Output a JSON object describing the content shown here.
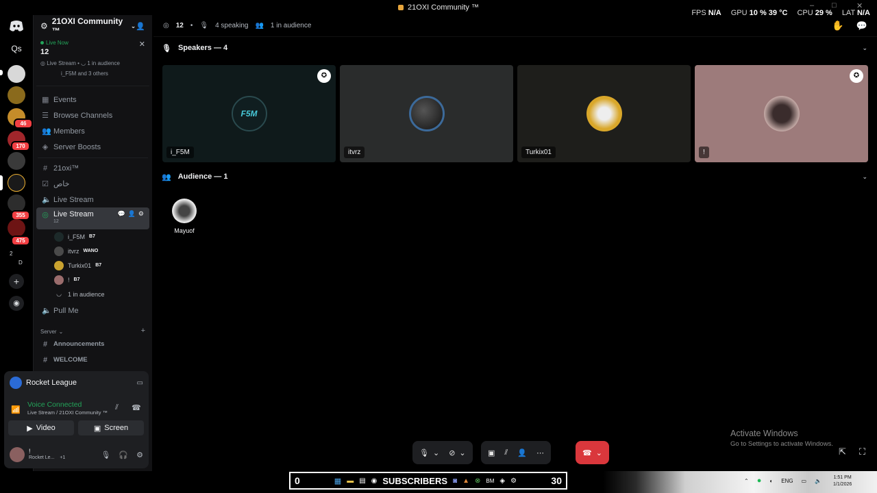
{
  "window": {
    "title": "21OXI Community ™",
    "controls": [
      "–",
      "□",
      "✕"
    ]
  },
  "perf": {
    "fps_label": "FPS",
    "fps_value": "N/A",
    "gpu_label": "GPU",
    "gpu_value": "10 %",
    "gpu_temp": "39 °C",
    "cpu_label": "CPU",
    "cpu_value": "29 %",
    "lat_label": "LAT",
    "lat_value": "N/A"
  },
  "rail": {
    "home_icon": "discord-icon",
    "dm_label": "Qs",
    "badges": [
      "46",
      "170",
      "355",
      "475"
    ],
    "folder_label_1": "2",
    "folder_label_2": "D"
  },
  "server": {
    "name": "21OXI Community ™"
  },
  "live_card": {
    "live_now": "Live Now",
    "count": "12",
    "meta_1": "Live Stream",
    "meta_2": "1 in audience",
    "users": "i_F5M and 3 others"
  },
  "nav": [
    "Events",
    "Browse Channels",
    "Members",
    "Server Boosts"
  ],
  "channels": {
    "ch1": "21oxi™",
    "ch2": "خاص",
    "ch3": "Live Stream",
    "active": {
      "name": "Live Stream",
      "count": "12"
    },
    "members": [
      {
        "name": "i_F5M",
        "tag": "B7"
      },
      {
        "name": "itvrz",
        "tag": "WANO"
      },
      {
        "name": "Turkix01",
        "tag": "B7"
      },
      {
        "name": "!",
        "tag": "B7"
      }
    ],
    "audience": "1 in audience",
    "pullme": "Pull Me",
    "category": "Server",
    "text1": "Announcements",
    "text2": "WELCOME"
  },
  "game": {
    "name": "Rocket League"
  },
  "voice": {
    "status": "Voice Connected",
    "location": "Live Stream / 21OXI Community ™",
    "video": "Video",
    "screen": "Screen"
  },
  "user": {
    "name": "!",
    "activity": "Rocket Le...",
    "extra": "+1"
  },
  "topbar": {
    "listeners": "12",
    "speaking": "4 speaking",
    "audience": "1 in audience"
  },
  "speakers": {
    "title": "Speakers — 4",
    "tiles": [
      {
        "name": "i_F5M",
        "logo": "F5M"
      },
      {
        "name": "itvrz"
      },
      {
        "name": "Turkix01"
      },
      {
        "name": "!"
      }
    ]
  },
  "audience": {
    "title": "Audience — 1",
    "member": "Mayuof"
  },
  "activate": {
    "title": "Activate Windows",
    "sub": "Go to Settings to activate Windows."
  },
  "taskbar": {
    "left": "0",
    "banner": "SUBSCRIBERS",
    "right": "30",
    "lang": "ENG",
    "time": "1:51 PM",
    "date": "1/1/2026",
    "app_bm": "BM"
  }
}
